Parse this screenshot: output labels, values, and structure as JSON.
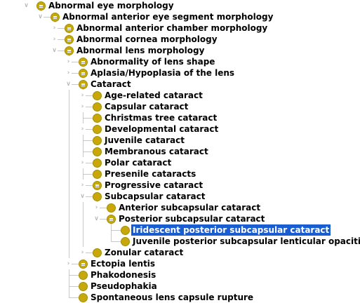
{
  "tree": {
    "nodes": [
      {
        "label": "Abnormal eye morphology",
        "depth": 0,
        "toggle": "open",
        "defined": true
      },
      {
        "label": "Abnormal anterior eye segment morphology",
        "depth": 1,
        "toggle": "open",
        "defined": true
      },
      {
        "label": "Abnormal anterior chamber morphology",
        "depth": 2,
        "toggle": "closed",
        "defined": true
      },
      {
        "label": "Abnormal cornea morphology",
        "depth": 2,
        "toggle": "closed",
        "defined": true
      },
      {
        "label": "Abnormal lens morphology",
        "depth": 2,
        "toggle": "open",
        "defined": true
      },
      {
        "label": "Abnormality of lens shape",
        "depth": 3,
        "toggle": "closed",
        "defined": true
      },
      {
        "label": "Aplasia/Hypoplasia of the lens",
        "depth": 3,
        "toggle": "closed",
        "defined": true
      },
      {
        "label": "Cataract",
        "depth": 3,
        "toggle": "open",
        "defined": true
      },
      {
        "label": "Age-related cataract",
        "depth": 4,
        "toggle": "closed",
        "defined": false
      },
      {
        "label": "Capsular cataract",
        "depth": 4,
        "toggle": "closed",
        "defined": false
      },
      {
        "label": "Christmas tree cataract",
        "depth": 4,
        "toggle": "none",
        "defined": false
      },
      {
        "label": "Developmental cataract",
        "depth": 4,
        "toggle": "closed",
        "defined": false
      },
      {
        "label": "Juvenile cataract",
        "depth": 4,
        "toggle": "none",
        "defined": false
      },
      {
        "label": "Membranous cataract",
        "depth": 4,
        "toggle": "none",
        "defined": false
      },
      {
        "label": "Polar cataract",
        "depth": 4,
        "toggle": "closed",
        "defined": false
      },
      {
        "label": "Presenile cataracts",
        "depth": 4,
        "toggle": "none",
        "defined": false
      },
      {
        "label": "Progressive cataract",
        "depth": 4,
        "toggle": "closed",
        "defined": true
      },
      {
        "label": "Subcapsular cataract",
        "depth": 4,
        "toggle": "open",
        "defined": false
      },
      {
        "label": "Anterior subcapsular cataract",
        "depth": 5,
        "toggle": "closed",
        "defined": false
      },
      {
        "label": "Posterior subcapsular cataract",
        "depth": 5,
        "toggle": "open",
        "defined": true
      },
      {
        "label": "Iridescent posterior subcapsular cataract",
        "depth": 6,
        "toggle": "none",
        "defined": false,
        "selected": true
      },
      {
        "label": "Juvenile posterior subcapsular lenticular opacities",
        "depth": 6,
        "toggle": "none",
        "defined": false
      },
      {
        "label": "Zonular cataract",
        "depth": 4,
        "toggle": "closed",
        "defined": false
      },
      {
        "label": "Ectopia lentis",
        "depth": 3,
        "toggle": "closed",
        "defined": true
      },
      {
        "label": "Phakodonesis",
        "depth": 3,
        "toggle": "none",
        "defined": false
      },
      {
        "label": "Pseudophakia",
        "depth": 3,
        "toggle": "none",
        "defined": false
      },
      {
        "label": "Spontaneous lens capsule rupture",
        "depth": 3,
        "toggle": "none",
        "defined": false
      }
    ],
    "colors": {
      "icon": "#c6a80a",
      "selection": "#1a5dd1",
      "guide_lines": "#c8c8c8"
    },
    "icon_names": {
      "defined_class": "defined-class-icon",
      "class": "class-icon",
      "expand": "chevron-right-icon",
      "collapse": "chevron-down-icon"
    }
  }
}
